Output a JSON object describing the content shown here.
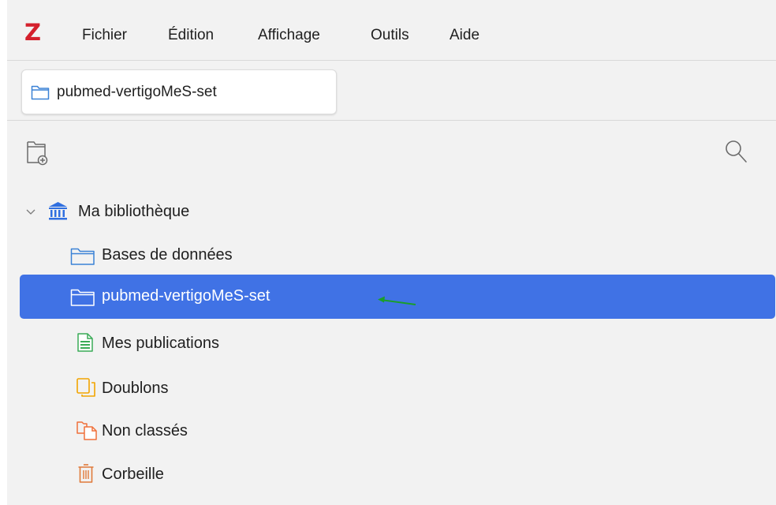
{
  "app": {
    "logo": "Z",
    "menu": [
      "Fichier",
      "Édition",
      "Affichage",
      "Outils",
      "Aide"
    ]
  },
  "tab": {
    "label": "pubmed-vertigoMeS-set",
    "icon": "folder-icon"
  },
  "toolbar": {
    "new_collection_icon": "new-collection-icon",
    "search_icon": "search-icon"
  },
  "tree": {
    "library": {
      "label": "Ma bibliothèque",
      "icon": "library-icon",
      "expanded": true
    },
    "items": [
      {
        "label": "Bases de données",
        "icon": "folder-icon",
        "selected": false
      },
      {
        "label": "pubmed-vertigoMeS-set",
        "icon": "folder-icon",
        "selected": true
      },
      {
        "label": "Mes publications",
        "icon": "publications-icon",
        "selected": false
      },
      {
        "label": "Doublons",
        "icon": "duplicates-icon",
        "selected": false
      },
      {
        "label": "Non classés",
        "icon": "unfiled-icon",
        "selected": false
      },
      {
        "label": "Corbeille",
        "icon": "trash-icon",
        "selected": false
      }
    ]
  },
  "colors": {
    "selection": "#4072e5",
    "logo": "#d4202c",
    "folder": "#3b82d6",
    "annotation_arrow": "#1a9e2a"
  }
}
